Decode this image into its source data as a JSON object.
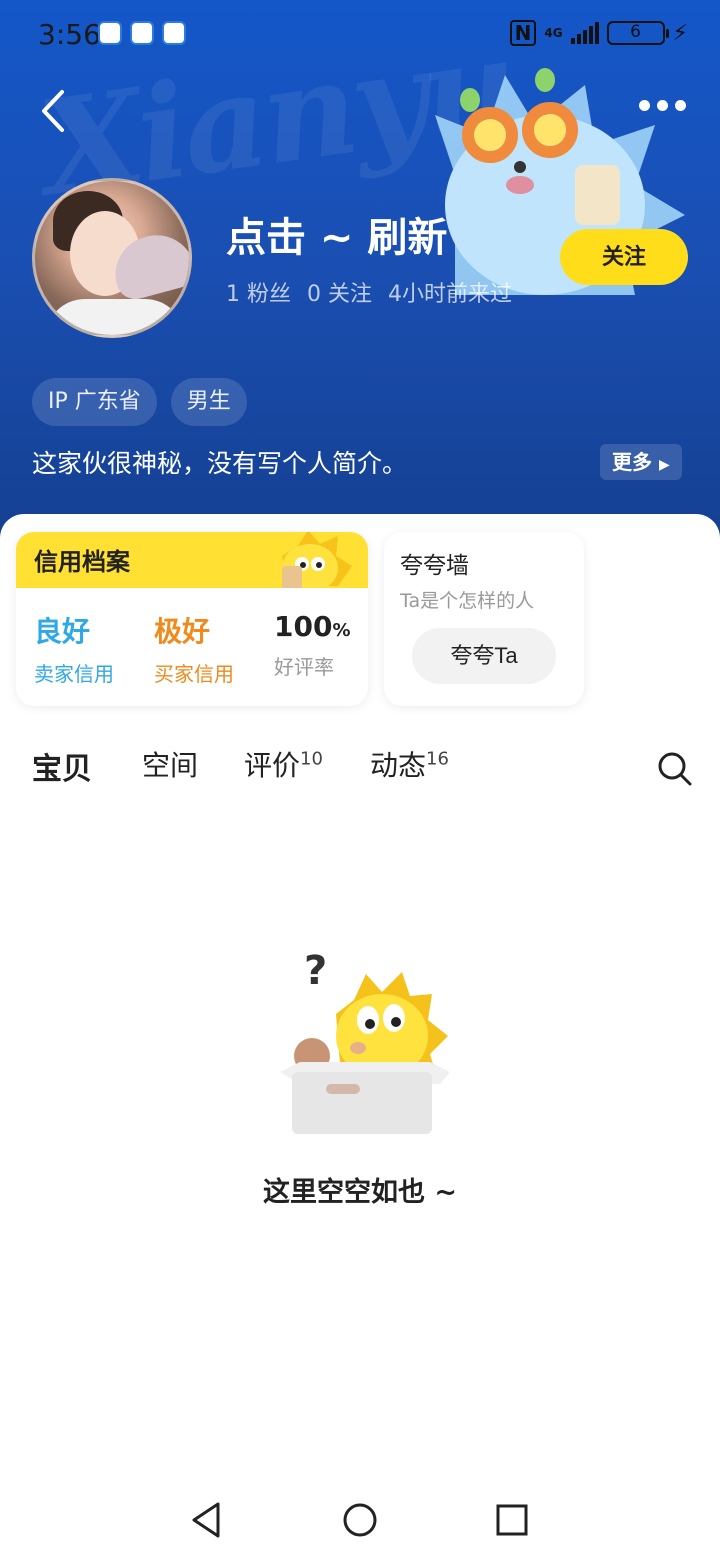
{
  "status_bar": {
    "time": "3:56",
    "network": "4G",
    "battery": "6"
  },
  "header": {
    "bg_word": "Xianyu",
    "username": "点击 ~ 刷新",
    "stats": [
      "1 粉丝",
      "0 关注",
      "4小时前来过"
    ],
    "follow_label": "关注",
    "tags": [
      "IP 广东省",
      "男生"
    ],
    "bio": "这家伙很神秘，没有写个人简介。",
    "more_label": "更多"
  },
  "credit": {
    "title": "信用档案",
    "items": [
      {
        "value": "良好",
        "label": "卖家信用",
        "color": "#2fa8e8"
      },
      {
        "value": "极好",
        "label": "买家信用",
        "color": "#f08a1c"
      },
      {
        "value": "100",
        "unit": "%",
        "label": "好评率",
        "color": "#222222"
      }
    ]
  },
  "praise": {
    "title": "夸夸墙",
    "subtitle": "Ta是个怎样的人",
    "button_label": "夸夸Ta"
  },
  "tabs": [
    {
      "label": "宝贝",
      "count": ""
    },
    {
      "label": "空间",
      "count": ""
    },
    {
      "label": "评价",
      "count": "10"
    },
    {
      "label": "动态",
      "count": "16"
    }
  ],
  "empty": {
    "text": "这里空空如也 ~"
  },
  "colors": {
    "header_blue": "#1a4fb3",
    "accent_yellow": "#ffdd1b"
  }
}
